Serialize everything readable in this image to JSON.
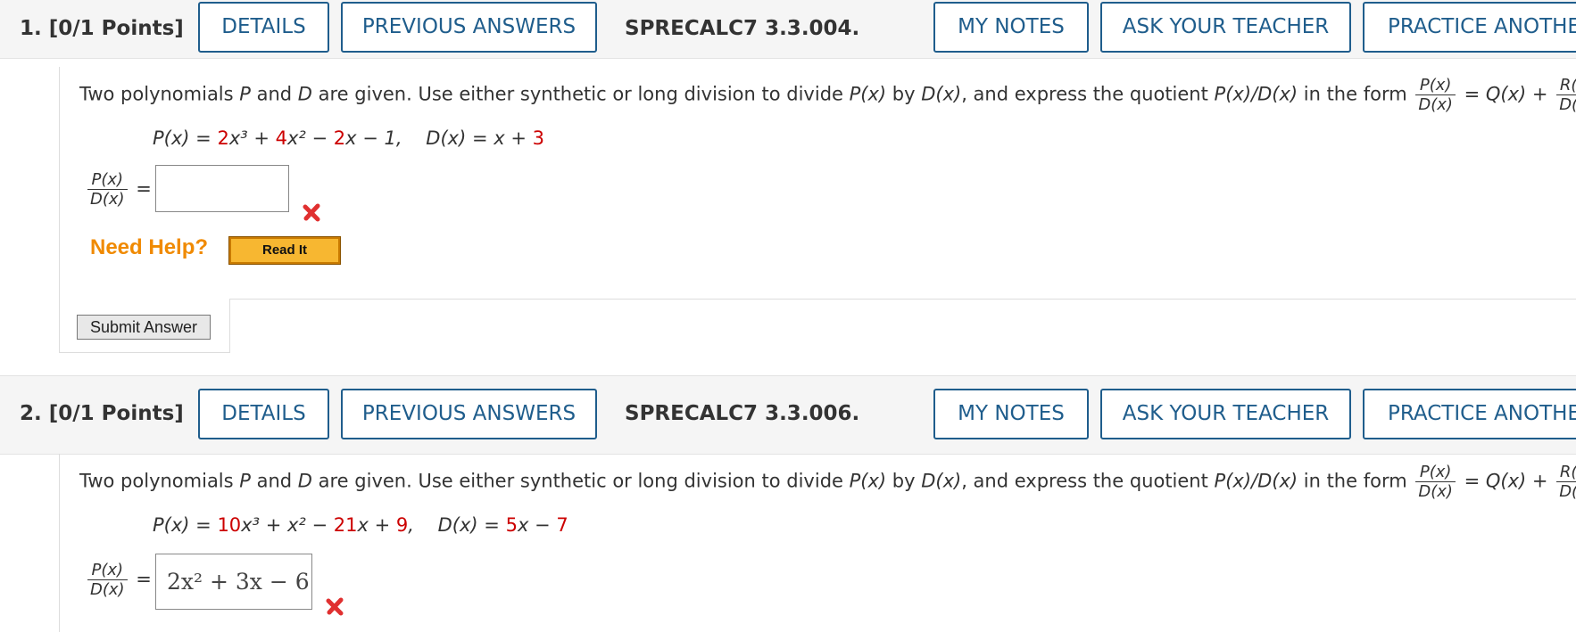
{
  "questions": [
    {
      "number_label": "1.  [0/1 Points]",
      "details": "DETAILS",
      "previous_answers": "PREVIOUS ANSWERS",
      "problem_id": "SPRECALC7 3.3.004.",
      "my_notes": "MY NOTES",
      "ask_teacher": "ASK YOUR TEACHER",
      "practice": "PRACTICE ANOTHER",
      "answer_value": "",
      "answer_status": "incorrect"
    },
    {
      "number_label": "2.  [0/1 Points]",
      "details": "DETAILS",
      "previous_answers": "PREVIOUS ANSWERS",
      "problem_id": "SPRECALC7 3.3.006.",
      "my_notes": "MY NOTES",
      "ask_teacher": "ASK YOUR TEACHER",
      "practice": "PRACTICE ANOTHER",
      "answer_value": "2x² + 3x − 6",
      "answer_status": "incorrect"
    }
  ],
  "prompt": {
    "text_a": "Two polynomials ",
    "text_b": " and ",
    "text_c": " are given. Use either synthetic or long division to divide  ",
    "text_d": "  by  ",
    "text_e": ",  and express the quotient  ",
    "text_f": "  in the form ",
    "P": "P",
    "D": "D",
    "Px": "P(x)",
    "Dx": "D(x)",
    "PoverD": "P(x)/D(x)",
    "Qx": "= Q(x) +",
    "Rx": "R(x)",
    "period": "."
  },
  "q1_eq": {
    "px_lhs": "P(x) = ",
    "c1": "2",
    "t1": "x³ + ",
    "c2": "4",
    "t2": "x² − ",
    "c3": "2",
    "t3": "x − 1,",
    "dx_lhs": "D(x) = x + ",
    "d1": "3"
  },
  "q2_eq": {
    "px_lhs": "P(x) = ",
    "c1": "10",
    "t1": "x³ + x² − ",
    "c2": "21",
    "t2": "x + ",
    "c3": "9",
    "t3": ",",
    "dx_lhs": "D(x) = ",
    "d1": "5",
    "t4": "x − ",
    "d2": "7"
  },
  "lhs": {
    "num": "P(x)",
    "den": "D(x)",
    "eq": "="
  },
  "help": {
    "label": "Need Help?",
    "read_it": "Read It"
  },
  "submit_label": "Submit Answer",
  "colors": {
    "button_border": "#1f5d8c",
    "highlight": "#cc0000",
    "help": "#f08a00"
  }
}
